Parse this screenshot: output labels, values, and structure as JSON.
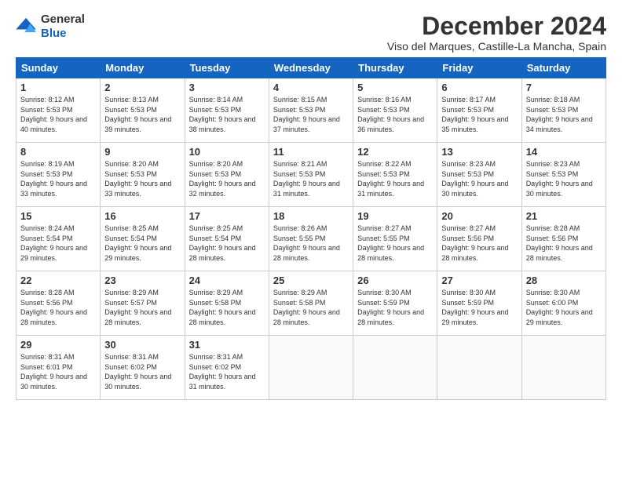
{
  "logo": {
    "general": "General",
    "blue": "Blue"
  },
  "title": "December 2024",
  "location": "Viso del Marques, Castille-La Mancha, Spain",
  "weekdays": [
    "Sunday",
    "Monday",
    "Tuesday",
    "Wednesday",
    "Thursday",
    "Friday",
    "Saturday"
  ],
  "weeks": [
    [
      {
        "day": "1",
        "sunrise": "Sunrise: 8:12 AM",
        "sunset": "Sunset: 5:53 PM",
        "daylight": "Daylight: 9 hours and 40 minutes."
      },
      {
        "day": "2",
        "sunrise": "Sunrise: 8:13 AM",
        "sunset": "Sunset: 5:53 PM",
        "daylight": "Daylight: 9 hours and 39 minutes."
      },
      {
        "day": "3",
        "sunrise": "Sunrise: 8:14 AM",
        "sunset": "Sunset: 5:53 PM",
        "daylight": "Daylight: 9 hours and 38 minutes."
      },
      {
        "day": "4",
        "sunrise": "Sunrise: 8:15 AM",
        "sunset": "Sunset: 5:53 PM",
        "daylight": "Daylight: 9 hours and 37 minutes."
      },
      {
        "day": "5",
        "sunrise": "Sunrise: 8:16 AM",
        "sunset": "Sunset: 5:53 PM",
        "daylight": "Daylight: 9 hours and 36 minutes."
      },
      {
        "day": "6",
        "sunrise": "Sunrise: 8:17 AM",
        "sunset": "Sunset: 5:53 PM",
        "daylight": "Daylight: 9 hours and 35 minutes."
      },
      {
        "day": "7",
        "sunrise": "Sunrise: 8:18 AM",
        "sunset": "Sunset: 5:53 PM",
        "daylight": "Daylight: 9 hours and 34 minutes."
      }
    ],
    [
      {
        "day": "8",
        "sunrise": "Sunrise: 8:19 AM",
        "sunset": "Sunset: 5:53 PM",
        "daylight": "Daylight: 9 hours and 33 minutes."
      },
      {
        "day": "9",
        "sunrise": "Sunrise: 8:20 AM",
        "sunset": "Sunset: 5:53 PM",
        "daylight": "Daylight: 9 hours and 33 minutes."
      },
      {
        "day": "10",
        "sunrise": "Sunrise: 8:20 AM",
        "sunset": "Sunset: 5:53 PM",
        "daylight": "Daylight: 9 hours and 32 minutes."
      },
      {
        "day": "11",
        "sunrise": "Sunrise: 8:21 AM",
        "sunset": "Sunset: 5:53 PM",
        "daylight": "Daylight: 9 hours and 31 minutes."
      },
      {
        "day": "12",
        "sunrise": "Sunrise: 8:22 AM",
        "sunset": "Sunset: 5:53 PM",
        "daylight": "Daylight: 9 hours and 31 minutes."
      },
      {
        "day": "13",
        "sunrise": "Sunrise: 8:23 AM",
        "sunset": "Sunset: 5:53 PM",
        "daylight": "Daylight: 9 hours and 30 minutes."
      },
      {
        "day": "14",
        "sunrise": "Sunrise: 8:23 AM",
        "sunset": "Sunset: 5:53 PM",
        "daylight": "Daylight: 9 hours and 30 minutes."
      }
    ],
    [
      {
        "day": "15",
        "sunrise": "Sunrise: 8:24 AM",
        "sunset": "Sunset: 5:54 PM",
        "daylight": "Daylight: 9 hours and 29 minutes."
      },
      {
        "day": "16",
        "sunrise": "Sunrise: 8:25 AM",
        "sunset": "Sunset: 5:54 PM",
        "daylight": "Daylight: 9 hours and 29 minutes."
      },
      {
        "day": "17",
        "sunrise": "Sunrise: 8:25 AM",
        "sunset": "Sunset: 5:54 PM",
        "daylight": "Daylight: 9 hours and 28 minutes."
      },
      {
        "day": "18",
        "sunrise": "Sunrise: 8:26 AM",
        "sunset": "Sunset: 5:55 PM",
        "daylight": "Daylight: 9 hours and 28 minutes."
      },
      {
        "day": "19",
        "sunrise": "Sunrise: 8:27 AM",
        "sunset": "Sunset: 5:55 PM",
        "daylight": "Daylight: 9 hours and 28 minutes."
      },
      {
        "day": "20",
        "sunrise": "Sunrise: 8:27 AM",
        "sunset": "Sunset: 5:56 PM",
        "daylight": "Daylight: 9 hours and 28 minutes."
      },
      {
        "day": "21",
        "sunrise": "Sunrise: 8:28 AM",
        "sunset": "Sunset: 5:56 PM",
        "daylight": "Daylight: 9 hours and 28 minutes."
      }
    ],
    [
      {
        "day": "22",
        "sunrise": "Sunrise: 8:28 AM",
        "sunset": "Sunset: 5:56 PM",
        "daylight": "Daylight: 9 hours and 28 minutes."
      },
      {
        "day": "23",
        "sunrise": "Sunrise: 8:29 AM",
        "sunset": "Sunset: 5:57 PM",
        "daylight": "Daylight: 9 hours and 28 minutes."
      },
      {
        "day": "24",
        "sunrise": "Sunrise: 8:29 AM",
        "sunset": "Sunset: 5:58 PM",
        "daylight": "Daylight: 9 hours and 28 minutes."
      },
      {
        "day": "25",
        "sunrise": "Sunrise: 8:29 AM",
        "sunset": "Sunset: 5:58 PM",
        "daylight": "Daylight: 9 hours and 28 minutes."
      },
      {
        "day": "26",
        "sunrise": "Sunrise: 8:30 AM",
        "sunset": "Sunset: 5:59 PM",
        "daylight": "Daylight: 9 hours and 28 minutes."
      },
      {
        "day": "27",
        "sunrise": "Sunrise: 8:30 AM",
        "sunset": "Sunset: 5:59 PM",
        "daylight": "Daylight: 9 hours and 29 minutes."
      },
      {
        "day": "28",
        "sunrise": "Sunrise: 8:30 AM",
        "sunset": "Sunset: 6:00 PM",
        "daylight": "Daylight: 9 hours and 29 minutes."
      }
    ],
    [
      {
        "day": "29",
        "sunrise": "Sunrise: 8:31 AM",
        "sunset": "Sunset: 6:01 PM",
        "daylight": "Daylight: 9 hours and 30 minutes."
      },
      {
        "day": "30",
        "sunrise": "Sunrise: 8:31 AM",
        "sunset": "Sunset: 6:02 PM",
        "daylight": "Daylight: 9 hours and 30 minutes."
      },
      {
        "day": "31",
        "sunrise": "Sunrise: 8:31 AM",
        "sunset": "Sunset: 6:02 PM",
        "daylight": "Daylight: 9 hours and 31 minutes."
      },
      null,
      null,
      null,
      null
    ]
  ]
}
